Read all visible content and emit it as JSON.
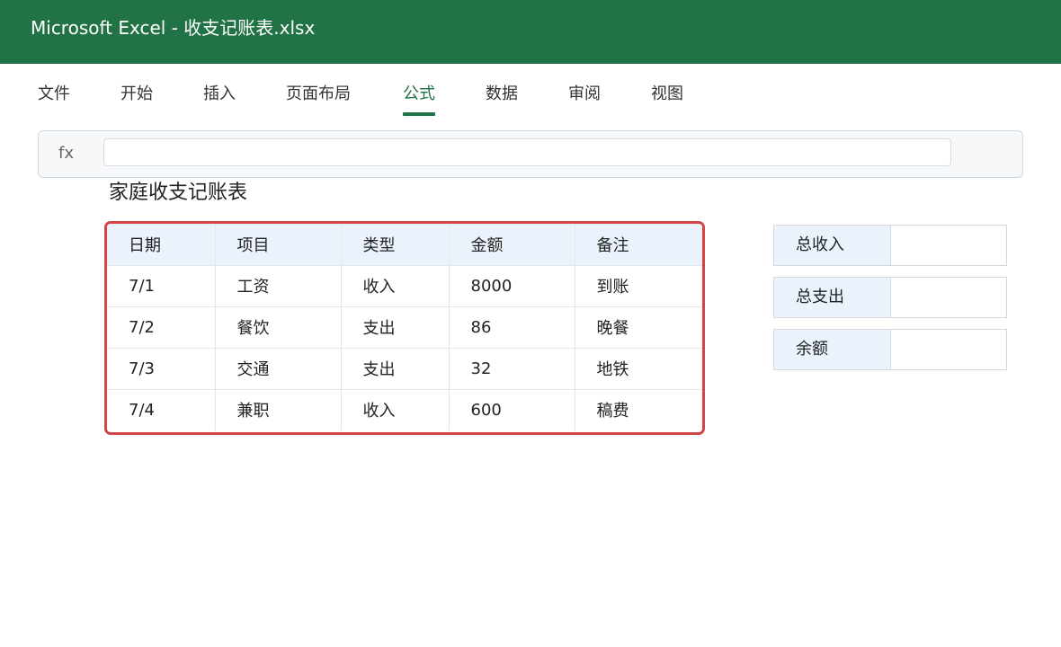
{
  "window": {
    "title": "Microsoft Excel - 收支记账表.xlsx"
  },
  "ribbon": {
    "tabs": [
      {
        "label": "文件",
        "active": false
      },
      {
        "label": "开始",
        "active": false
      },
      {
        "label": "插入",
        "active": false
      },
      {
        "label": "页面布局",
        "active": false
      },
      {
        "label": "公式",
        "active": true
      },
      {
        "label": "数据",
        "active": false
      },
      {
        "label": "审阅",
        "active": false
      },
      {
        "label": "视图",
        "active": false
      }
    ]
  },
  "formula_bar": {
    "fx_label": "fx",
    "value": ""
  },
  "sheet": {
    "title": "家庭收支记账表",
    "table": {
      "headers": [
        "日期",
        "项目",
        "类型",
        "金额",
        "备注"
      ],
      "rows": [
        [
          "7/1",
          "工资",
          "收入",
          "8000",
          "到账"
        ],
        [
          "7/2",
          "餐饮",
          "支出",
          "86",
          "晚餐"
        ],
        [
          "7/3",
          "交通",
          "支出",
          "32",
          "地铁"
        ],
        [
          "7/4",
          "兼职",
          "收入",
          "600",
          "稿费"
        ]
      ]
    },
    "summary": [
      {
        "label": "总收入",
        "value": ""
      },
      {
        "label": "总支出",
        "value": ""
      },
      {
        "label": "余额",
        "value": ""
      }
    ]
  },
  "colors": {
    "brand": "#217346",
    "selection_border": "#d64545",
    "header_fill": "#eaf3fc"
  }
}
